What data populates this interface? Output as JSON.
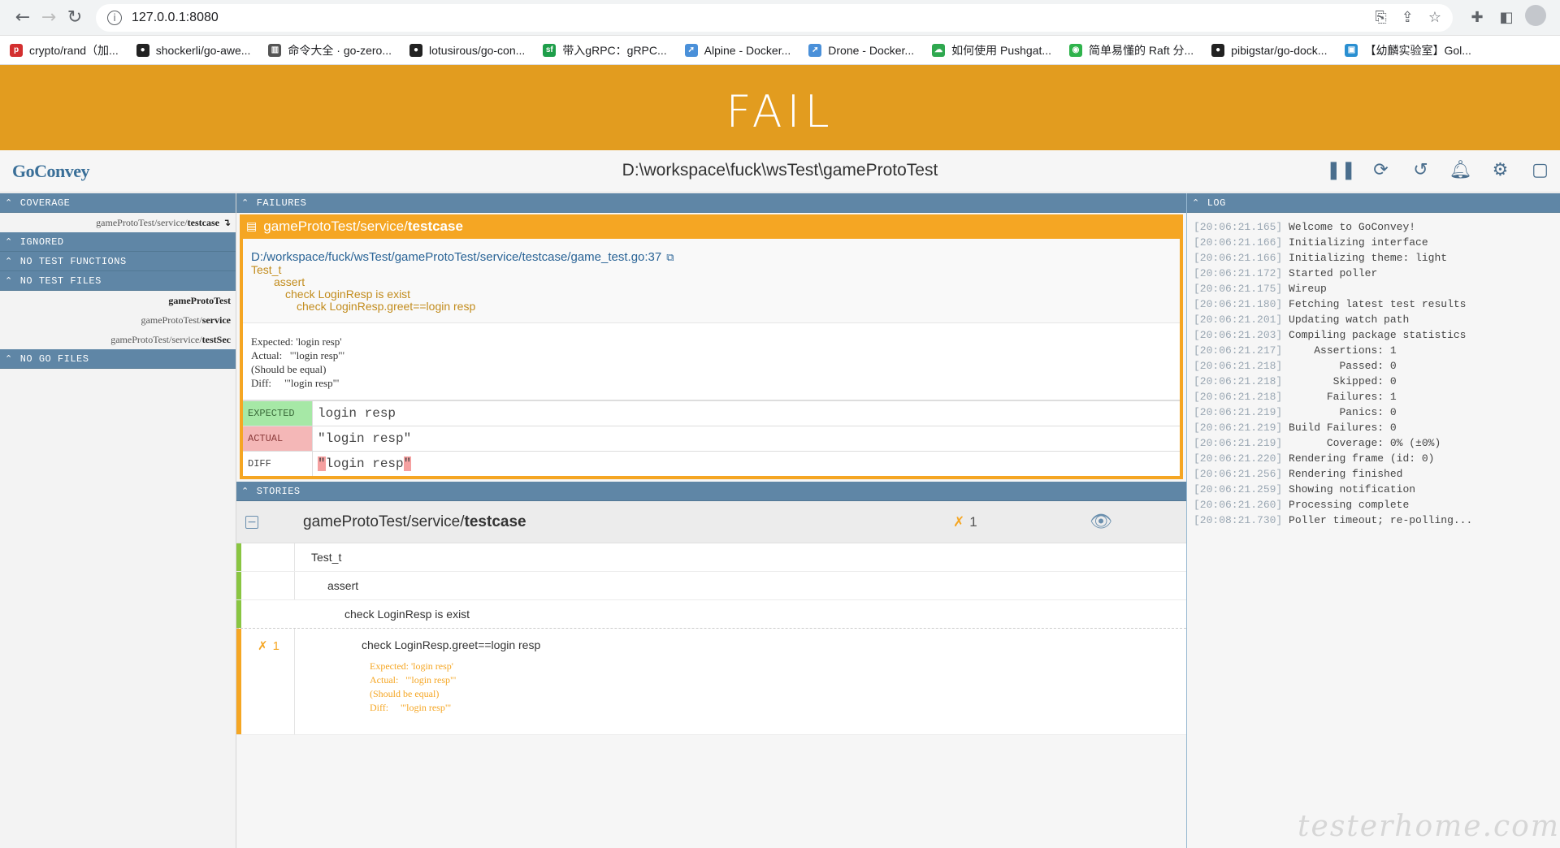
{
  "browser": {
    "url": "127.0.0.1:8080",
    "bookmarks": [
      {
        "label": "crypto/rand（加...",
        "icon": "php-icon",
        "color": "#d32f2f"
      },
      {
        "label": "shockerli/go-awe...",
        "icon": "github-icon",
        "color": "#222222"
      },
      {
        "label": "命令大全 · go-zero...",
        "icon": "book-icon",
        "color": "#555555"
      },
      {
        "label": "lotusirous/go-con...",
        "icon": "github-icon",
        "color": "#222222"
      },
      {
        "label": "带入gRPC：gRPC...",
        "icon": "sf-icon",
        "color": "#1e9e4a"
      },
      {
        "label": "Alpine - Docker...",
        "icon": "rocket-icon",
        "color": "#4a90d9"
      },
      {
        "label": "Drone - Docker...",
        "icon": "rocket-icon",
        "color": "#4a90d9"
      },
      {
        "label": "如何使用 Pushgat...",
        "icon": "cloud-icon",
        "color": "#2fa84f"
      },
      {
        "label": "简单易懂的 Raft 分...",
        "icon": "wechat-icon",
        "color": "#2fb34c"
      },
      {
        "label": "pibigstar/go-dock...",
        "icon": "github-icon",
        "color": "#222222"
      },
      {
        "label": "【幼麟实验室】Gol...",
        "icon": "tv-icon",
        "color": "#2a8fd1"
      }
    ]
  },
  "banner": {
    "status": "FAIL",
    "color": "#e29c1f"
  },
  "app": {
    "logo": "GoConvey",
    "path": "D:\\workspace\\fuck\\wsTest\\gameProtoTest"
  },
  "left": {
    "coverage_title": "COVERAGE",
    "coverage_item_prefix": "gameProtoTest/service/",
    "coverage_item_bold": "testcase",
    "ignored_title": "IGNORED",
    "no_test_functions_title": "NO TEST FUNCTIONS",
    "no_test_files_title": "NO TEST FILES",
    "no_test_files": [
      {
        "prefix": "",
        "bold": "gameProtoTest"
      },
      {
        "prefix": "gameProtoTest/",
        "bold": "service"
      },
      {
        "prefix": "gameProtoTest/service/",
        "bold": "testSec"
      }
    ],
    "no_go_files_title": "NO GO FILES"
  },
  "failures": {
    "title": "FAILURES",
    "pkg_prefix": "gameProtoTest/service/",
    "pkg_bold": "testcase",
    "file_link": "D:/workspace/fuck/wsTest/gameProtoTest/service/testcase/game_test.go:37",
    "stack": [
      "Test_t",
      "assert",
      "check LoginResp is exist",
      "check LoginResp.greet==login resp"
    ],
    "message": "Expected: 'login resp'\nActual:   '\"login resp\"'\n(Should be equal)\nDiff:     '\"login resp\"'",
    "expected_label": "EXPECTED",
    "expected_value": "login resp",
    "actual_label": "ACTUAL",
    "actual_value": "\"login resp\"",
    "diff_label": "DIFF",
    "diff_quote": "\"",
    "diff_body": "login resp"
  },
  "stories": {
    "title": "STORIES",
    "pkg_prefix": "gameProtoTest/service/",
    "pkg_bold": "testcase",
    "fail_count": "1",
    "rows": [
      {
        "label": "Test_t"
      },
      {
        "label": "assert"
      },
      {
        "label": "check LoginResp is exist"
      },
      {
        "label": "check LoginResp.greet==login resp",
        "fail_count": "1"
      }
    ],
    "error_text": "Expected: 'login resp'\nActual:   '\"login resp\"'\n(Should be equal)\nDiff:     '\"login resp\"'"
  },
  "log": {
    "title": "LOG",
    "entries": [
      {
        "ts": "[20:06:21.165]",
        "msg": "Welcome to GoConvey!"
      },
      {
        "ts": "[20:06:21.166]",
        "msg": "Initializing interface"
      },
      {
        "ts": "[20:06:21.166]",
        "msg": "Initializing theme: light"
      },
      {
        "ts": "[20:06:21.172]",
        "msg": "Started poller"
      },
      {
        "ts": "[20:06:21.175]",
        "msg": "Wireup"
      },
      {
        "ts": "[20:06:21.180]",
        "msg": "Fetching latest test results"
      },
      {
        "ts": "[20:06:21.201]",
        "msg": "Updating watch path"
      },
      {
        "ts": "[20:06:21.203]",
        "msg": "Compiling package statistics"
      },
      {
        "ts": "[20:06:21.217]",
        "msg": "    Assertions: 1"
      },
      {
        "ts": "[20:06:21.218]",
        "msg": "        Passed: 0"
      },
      {
        "ts": "[20:06:21.218]",
        "msg": "       Skipped: 0"
      },
      {
        "ts": "[20:06:21.218]",
        "msg": "      Failures: 1"
      },
      {
        "ts": "[20:06:21.219]",
        "msg": "        Panics: 0"
      },
      {
        "ts": "[20:06:21.219]",
        "msg": "Build Failures: 0"
      },
      {
        "ts": "[20:06:21.219]",
        "msg": "      Coverage: 0% (±0%)"
      },
      {
        "ts": "[20:06:21.220]",
        "msg": "Rendering frame (id: 0)"
      },
      {
        "ts": "[20:06:21.256]",
        "msg": "Rendering finished"
      },
      {
        "ts": "[20:06:21.259]",
        "msg": "Showing notification"
      },
      {
        "ts": "[20:06:21.260]",
        "msg": "Processing complete"
      },
      {
        "ts": "[20:08:21.730]",
        "msg": "Poller timeout; re-polling..."
      }
    ]
  },
  "watermark": "testerhome.com"
}
